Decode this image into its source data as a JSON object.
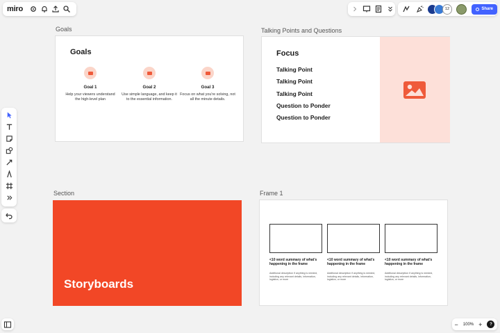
{
  "app": {
    "logo": "miro",
    "brand_color": "#ffd02f",
    "accent_color": "#4262ff"
  },
  "topbar": {
    "share_label": "Share",
    "collaborator_count": "12"
  },
  "goals_frame": {
    "label": "Goals",
    "heading": "Goals",
    "goals": [
      {
        "title": "Goal 1",
        "desc": "Help your viewers understand the high-level plan"
      },
      {
        "title": "Goal 2",
        "desc": "Use simple language, and keep it to the essential information."
      },
      {
        "title": "Goal 3",
        "desc": "Focus on what you're solving, not all the minute details."
      }
    ]
  },
  "talking_frame": {
    "label": "Talking Points and Questions",
    "heading": "Focus",
    "items": [
      "Talking Point",
      "Talking Point",
      "Talking Point",
      "Question to Ponder",
      "Question to Ponder"
    ],
    "image_panel_color": "#fde0d9",
    "image_icon_color": "#ef5a3a"
  },
  "section_frame": {
    "label": "Section",
    "title": "Storyboards",
    "color": "#f24726"
  },
  "frame1": {
    "label": "Frame 1",
    "cards": [
      {
        "title": "<10 word summary of what's happening in the frame",
        "desc": "Additional description if anything is needed, including any relevant details, information, logistics, or more"
      },
      {
        "title": "<10 word summary of what's happening in the frame",
        "desc": "Additional description if anything is needed, including any relevant details, information, logistics, or more"
      },
      {
        "title": "<10 word summary of what's happening in the frame",
        "desc": "Additional description if anything is needed, including any relevant details, information, logistics, or more"
      }
    ]
  },
  "zoom": {
    "level": "100%",
    "minus": "−",
    "plus": "+",
    "help": "?"
  }
}
